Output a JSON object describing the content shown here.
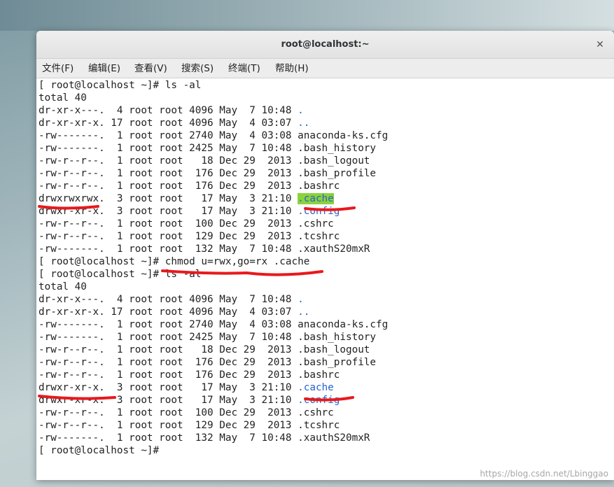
{
  "window": {
    "title": "root@localhost:~"
  },
  "menu": [
    {
      "label": "文件(F)"
    },
    {
      "label": "编辑(E)"
    },
    {
      "label": "查看(V)"
    },
    {
      "label": "搜索(S)"
    },
    {
      "label": "终端(T)"
    },
    {
      "label": "帮助(H)"
    }
  ],
  "terminal": {
    "lines": [
      {
        "pre": "[ root@localhost ~]# ls -al",
        "name": "",
        "cls": ""
      },
      {
        "pre": "total 40",
        "name": "",
        "cls": ""
      },
      {
        "pre": "dr-xr-x---.  4 root root 4096 May  7 10:48 ",
        "name": ".",
        "cls": "blue"
      },
      {
        "pre": "dr-xr-xr-x. 17 root root 4096 May  4 03:07 ",
        "name": "..",
        "cls": "blue"
      },
      {
        "pre": "-rw-------.  1 root root 2740 May  4 03:08 ",
        "name": "anaconda-ks.cfg",
        "cls": ""
      },
      {
        "pre": "-rw-------.  1 root root 2425 May  7 10:48 ",
        "name": ".bash_history",
        "cls": ""
      },
      {
        "pre": "-rw-r--r--.  1 root root   18 Dec 29  2013 ",
        "name": ".bash_logout",
        "cls": ""
      },
      {
        "pre": "-rw-r--r--.  1 root root  176 Dec 29  2013 ",
        "name": ".bash_profile",
        "cls": ""
      },
      {
        "pre": "-rw-r--r--.  1 root root  176 Dec 29  2013 ",
        "name": ".bashrc",
        "cls": ""
      },
      {
        "pre": "drwxrwxrwx.  3 root root   17 May  3 21:10 ",
        "name": ".cache",
        "cls": "hl"
      },
      {
        "pre": "drwxr-xr-x.  3 root root   17 May  3 21:10 ",
        "name": ".config",
        "cls": "blue"
      },
      {
        "pre": "-rw-r--r--.  1 root root  100 Dec 29  2013 ",
        "name": ".cshrc",
        "cls": ""
      },
      {
        "pre": "-rw-r--r--.  1 root root  129 Dec 29  2013 ",
        "name": ".tcshrc",
        "cls": ""
      },
      {
        "pre": "-rw-------.  1 root root  132 May  7 10:48 ",
        "name": ".xauthS20mxR",
        "cls": ""
      },
      {
        "pre": "[ root@localhost ~]# chmod u=rwx,go=rx .cache",
        "name": "",
        "cls": ""
      },
      {
        "pre": "[ root@localhost ~]# ls -al",
        "name": "",
        "cls": ""
      },
      {
        "pre": "total 40",
        "name": "",
        "cls": ""
      },
      {
        "pre": "dr-xr-x---.  4 root root 4096 May  7 10:48 ",
        "name": ".",
        "cls": "blue"
      },
      {
        "pre": "dr-xr-xr-x. 17 root root 4096 May  4 03:07 ",
        "name": "..",
        "cls": "blue"
      },
      {
        "pre": "-rw-------.  1 root root 2740 May  4 03:08 ",
        "name": "anaconda-ks.cfg",
        "cls": ""
      },
      {
        "pre": "-rw-------.  1 root root 2425 May  7 10:48 ",
        "name": ".bash_history",
        "cls": ""
      },
      {
        "pre": "-rw-r--r--.  1 root root   18 Dec 29  2013 ",
        "name": ".bash_logout",
        "cls": ""
      },
      {
        "pre": "-rw-r--r--.  1 root root  176 Dec 29  2013 ",
        "name": ".bash_profile",
        "cls": ""
      },
      {
        "pre": "-rw-r--r--.  1 root root  176 Dec 29  2013 ",
        "name": ".bashrc",
        "cls": ""
      },
      {
        "pre": "drwxr-xr-x.  3 root root   17 May  3 21:10 ",
        "name": ".cache",
        "cls": "blue"
      },
      {
        "pre": "drwxr-xr-x.  3 root root   17 May  3 21:10 ",
        "name": ".config",
        "cls": "blue"
      },
      {
        "pre": "-rw-r--r--.  1 root root  100 Dec 29  2013 ",
        "name": ".cshrc",
        "cls": ""
      },
      {
        "pre": "-rw-r--r--.  1 root root  129 Dec 29  2013 ",
        "name": ".tcshrc",
        "cls": ""
      },
      {
        "pre": "-rw-------.  1 root root  132 May  7 10:48 ",
        "name": ".xauthS20mxR",
        "cls": ""
      },
      {
        "pre": "[ root@localhost ~]# ",
        "name": "",
        "cls": ""
      }
    ]
  },
  "watermark": "https://blog.csdn.net/Lbinggao",
  "colors": {
    "dir_blue": "#2a62c9",
    "highlight_green": "#8ad33c",
    "annotation_red": "#e8191d"
  }
}
